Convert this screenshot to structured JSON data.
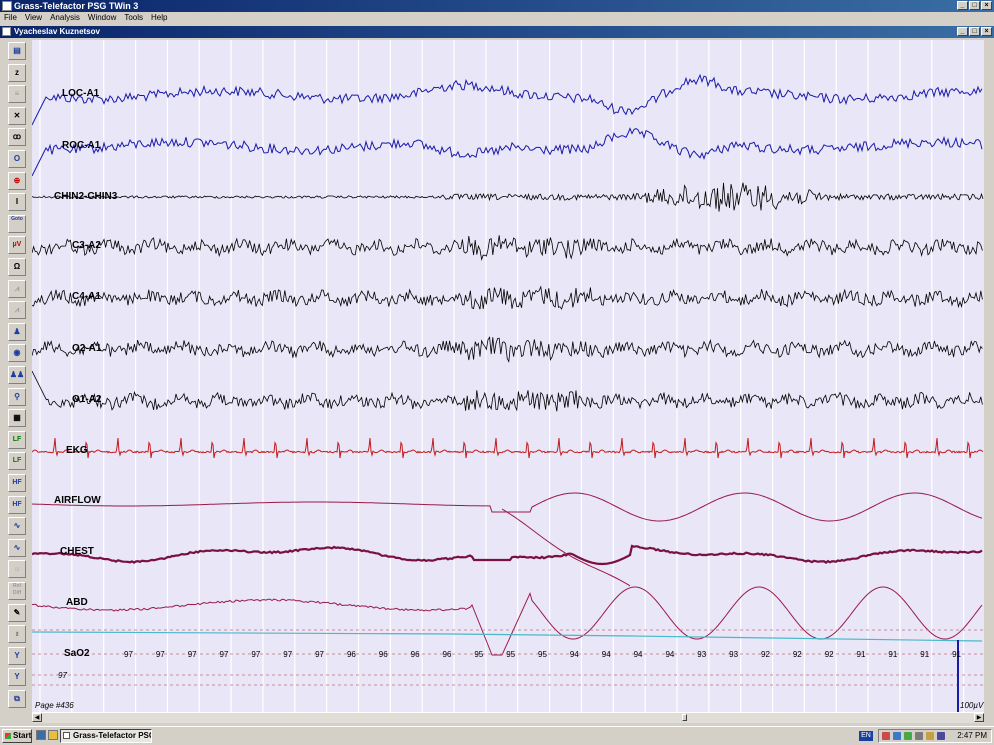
{
  "app": {
    "title": "Grass-Telefactor PSG TWin 3",
    "menu": [
      "File",
      "View",
      "Analysis",
      "Window",
      "Tools",
      "Help"
    ],
    "child_window_title": "Vyacheslav Kuznetsov"
  },
  "toolbar": {
    "buttons": [
      {
        "icon": "save-icon",
        "glyph": "▤"
      },
      {
        "icon": "zoom-z-icon",
        "glyph": "z"
      },
      {
        "icon": "montage-icon",
        "glyph": "≡"
      },
      {
        "icon": "hide-channel-icon",
        "glyph": "✕"
      },
      {
        "icon": "filter-icon",
        "glyph": "ꝏ"
      },
      {
        "icon": "key-icon",
        "glyph": "O"
      },
      {
        "icon": "target-icon",
        "glyph": "⊕"
      },
      {
        "icon": "cursor-icon",
        "glyph": "I"
      },
      {
        "label": "Goto"
      },
      {
        "label": "µV"
      },
      {
        "icon": "impedance-icon",
        "glyph": "Ω"
      },
      {
        "icon": "wave-icon",
        "glyph": "⩘"
      },
      {
        "icon": "wave2-icon",
        "glyph": "⩘"
      },
      {
        "icon": "person-icon",
        "glyph": "♟"
      },
      {
        "icon": "record-icon",
        "glyph": "◉"
      },
      {
        "icon": "people-icon",
        "glyph": "♟♟"
      },
      {
        "icon": "search-icon",
        "glyph": "⚲"
      },
      {
        "icon": "print-icon",
        "glyph": "▦"
      },
      {
        "label": "LF"
      },
      {
        "label": "LF"
      },
      {
        "label": "HF"
      },
      {
        "label": "HF"
      },
      {
        "icon": "sine-icon",
        "glyph": "∿"
      },
      {
        "icon": "sine2-icon",
        "glyph": "∿"
      },
      {
        "icon": "bulb-icon",
        "glyph": "☼"
      },
      {
        "label": "Ref Diff"
      },
      {
        "icon": "pen-icon",
        "glyph": "✎"
      },
      {
        "icon": "lightbulb-icon",
        "glyph": "♁"
      },
      {
        "icon": "adjust-icon",
        "glyph": "Y"
      },
      {
        "icon": "adjust2-icon",
        "glyph": "Y"
      },
      {
        "icon": "network-icon",
        "glyph": "⧉"
      }
    ]
  },
  "channels": [
    {
      "label": "LOC-A1",
      "color": "#1a1aa8"
    },
    {
      "label": "ROC-A1",
      "color": "#1a1aa8"
    },
    {
      "label": "CHIN2-CHIN3",
      "color": "#000000"
    },
    {
      "label": "C3-A2",
      "color": "#000000"
    },
    {
      "label": "C4-A1",
      "color": "#000000"
    },
    {
      "label": "O2-A1",
      "color": "#000000"
    },
    {
      "label": "O1-A2",
      "color": "#000000"
    },
    {
      "label": "EKG",
      "color": "#c41a1a"
    },
    {
      "label": "AIRFLOW",
      "color": "#9a1a4a"
    },
    {
      "label": "CHEST",
      "color": "#7a1040"
    },
    {
      "label": "ABD",
      "color": "#9a1a4a"
    },
    {
      "label": "SaO2",
      "color": "#000000"
    }
  ],
  "sao2": {
    "values": [
      "97",
      "97",
      "97",
      "97",
      "97",
      "97",
      "97",
      "96",
      "96",
      "96",
      "96",
      "95",
      "95",
      "95",
      "94",
      "94",
      "94",
      "94",
      "93",
      "93",
      "92",
      "92",
      "92",
      "91",
      "91",
      "91",
      "91"
    ],
    "extra_label": "97",
    "line_color": "#4ab8c8"
  },
  "status": {
    "page": "Page #436",
    "scale": "100µV"
  },
  "taskbar": {
    "start": "Start",
    "task": "Grass-Telefactor PSG ...",
    "lang": "EN",
    "clock": "2:47 PM"
  },
  "colors": {
    "plot_background": "#e8e6f7",
    "title_active": "#0a246a",
    "grid": "#ffffff",
    "apnea_marker": "#1a1aa8"
  }
}
